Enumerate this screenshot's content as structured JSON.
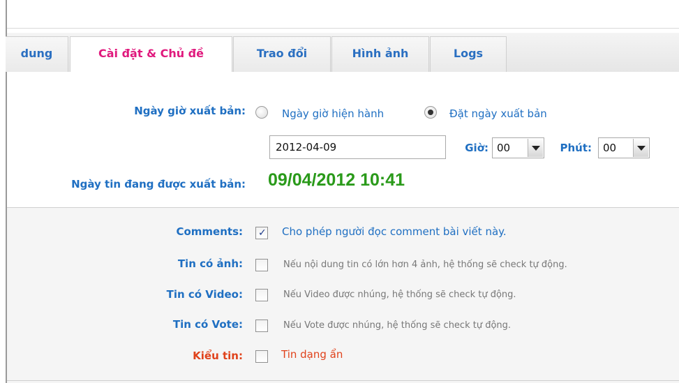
{
  "tabs": [
    {
      "label": "dung"
    },
    {
      "label": "Cài đặt & Chủ đề"
    },
    {
      "label": "Trao đổi"
    },
    {
      "label": "Hình ảnh"
    },
    {
      "label": "Logs"
    }
  ],
  "publish": {
    "label": "Ngày giờ xuất bản:",
    "option_current": "Ngày giờ hiện hành",
    "option_set": "Đặt ngày xuất bản",
    "selected": "option_set",
    "date_value": "2012-04-09",
    "hour_label": "Giờ:",
    "hour_value": "00",
    "minute_label": "Phút:",
    "minute_value": "00"
  },
  "published": {
    "label": "Ngày tin đang được xuất bản:",
    "value": "09/04/2012 10:41"
  },
  "options": {
    "comments": {
      "label": "Comments:",
      "text": "Cho phép người đọc comment bài viết này.",
      "checked": true
    },
    "image_news": {
      "label": "Tin có ảnh:",
      "text": "Nếu nội dung tin có lớn hơn 4 ảnh, hệ thống sẽ check tự động.",
      "checked": false
    },
    "video_news": {
      "label": "Tin có Video:",
      "text": "Nếu Video được nhúng, hệ thống sẽ check tự động.",
      "checked": false
    },
    "vote_news": {
      "label": "Tin có Vote:",
      "text": "Nếu Vote được nhúng, hệ thống sẽ check tự động.",
      "checked": false
    },
    "news_type": {
      "label": "Kiểu tin:",
      "text": "Tin dạng ẩn",
      "checked": false
    }
  },
  "colors": {
    "tab_active": "#e0197d",
    "label_blue": "#1f6fc2",
    "label_red": "#e0421b",
    "date_green": "#2a9a1a"
  }
}
